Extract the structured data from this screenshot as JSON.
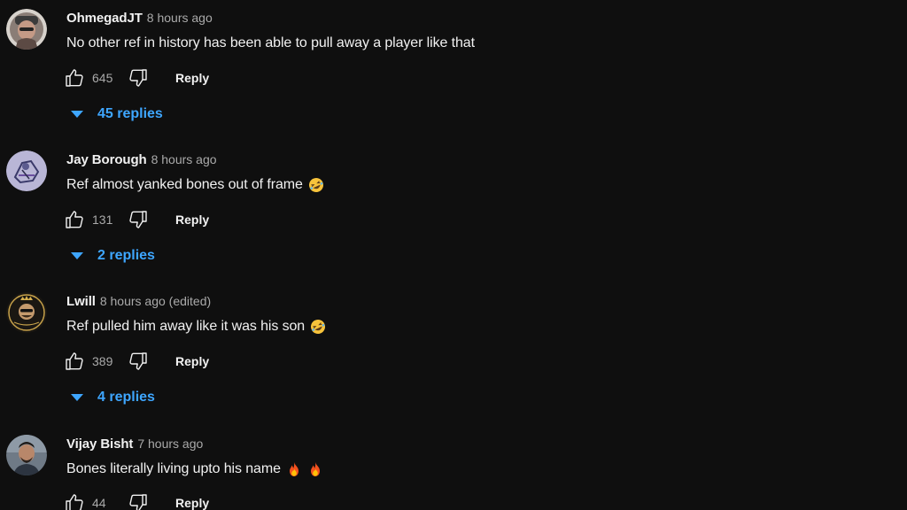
{
  "colors": {
    "background": "#0f0f0f",
    "text": "#f1f1f1",
    "muted": "#aaaaaa",
    "link": "#3ea6ff"
  },
  "comments": [
    {
      "author": "OhmegadJT",
      "time": "8 hours ago",
      "text": "No other ref in history has been able to pull away a player like that",
      "emojis": [],
      "likes": "645",
      "reply_label": "Reply",
      "replies_label": "45 replies",
      "avatar_icon": "avatar-photo"
    },
    {
      "author": "Jay Borough",
      "time": "8 hours ago",
      "text": "Ref almost yanked bones out of frame",
      "emojis": [
        "rolling-on-floor-laughing"
      ],
      "likes": "131",
      "reply_label": "Reply",
      "replies_label": "2 replies",
      "avatar_icon": "avatar-sketch"
    },
    {
      "author": "Lwill",
      "time": "8 hours ago (edited)",
      "text": "Ref pulled him away like it was his son",
      "emojis": [
        "rolling-on-floor-laughing"
      ],
      "likes": "389",
      "reply_label": "Reply",
      "replies_label": "4 replies",
      "avatar_icon": "avatar-crown-badge"
    },
    {
      "author": "Vijay Bisht",
      "time": "7 hours ago",
      "text": "Bones literally living upto his name",
      "emojis": [
        "fire",
        "fire"
      ],
      "likes": "44",
      "reply_label": "Reply",
      "replies_label": "",
      "avatar_icon": "avatar-photo"
    }
  ]
}
